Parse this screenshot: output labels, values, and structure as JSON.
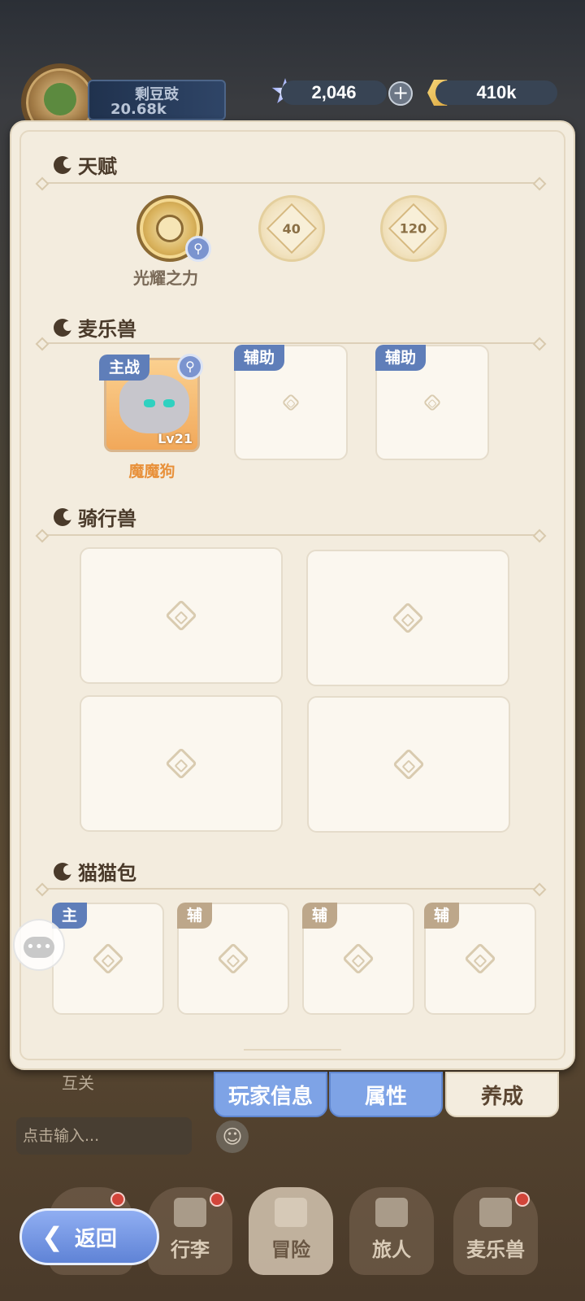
{
  "player": {
    "name": "剩豆豉",
    "power": "20.68k"
  },
  "currencies": {
    "gems": "2,046",
    "gold": "410k"
  },
  "talent": {
    "title": "天赋",
    "main_label": "光耀之力",
    "locked": [
      "40",
      "120"
    ]
  },
  "mailebeast": {
    "title": "麦乐兽",
    "main_tag": "主战",
    "pet_name": "魔魔狗",
    "pet_level": "Lv21",
    "assist_tag": "辅助"
  },
  "mount": {
    "title": "骑行兽"
  },
  "catbag": {
    "title": "猫猫包",
    "tags": [
      "主",
      "辅",
      "辅",
      "辅"
    ]
  },
  "panel_tabs": [
    "玩家信息",
    "属性",
    "养成"
  ],
  "background": {
    "mutual": "互关",
    "chat_placeholder": "点击输入..."
  },
  "nav": [
    "行李",
    "冒险",
    "旅人",
    "麦乐兽"
  ],
  "back_label": "返回",
  "colors": {
    "accent_blue": "#7ea3e6",
    "panel_bg": "#f3ecde",
    "pet_name": "#e8913b"
  }
}
